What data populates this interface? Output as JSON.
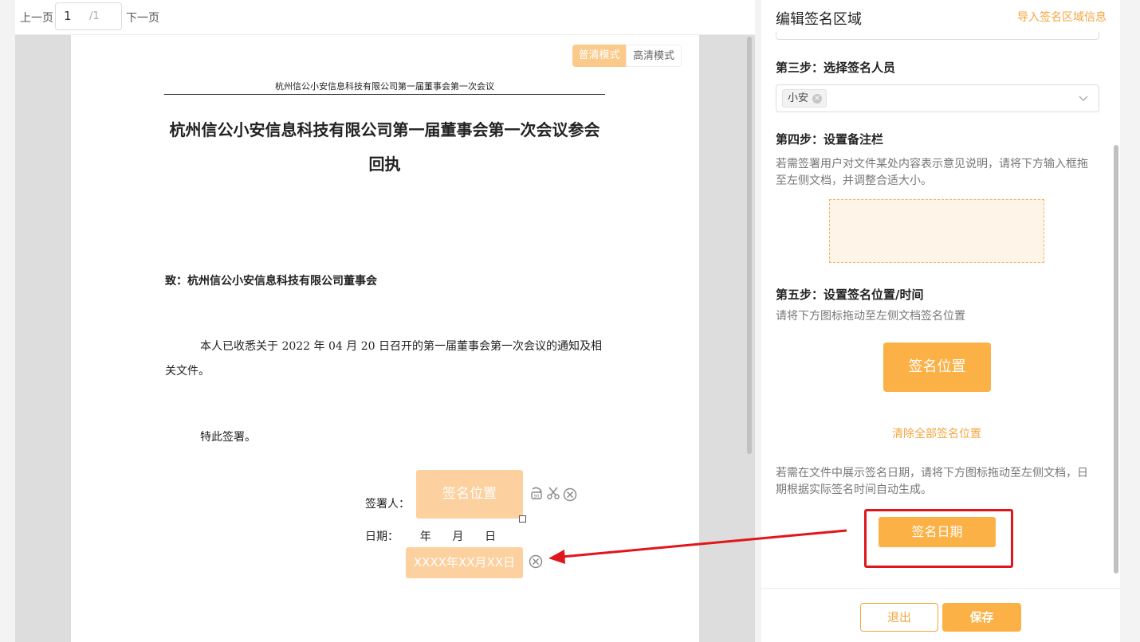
{
  "pager": {
    "prev_label": "上一页",
    "current_page": "1",
    "total_pages": "/1",
    "next_label": "下一页"
  },
  "viewer": {
    "mode_normal": "普清模式",
    "mode_hd": "高清模式"
  },
  "document": {
    "header": "杭州信公小安信息科技有限公司第一届董事会第一次会议",
    "title": "杭州信公小安信息科技有限公司第一届董事会第一次会议参会回执",
    "to": "致：杭州信公小安信息科技有限公司董事会",
    "body": "本人已收悉关于 2022 年 04 月 20 日召开的第一届董事会第一次会议的通知及相关文件。",
    "closing": "特此签署。",
    "signer_label": "签署人：",
    "date_label": "日期：      年      月      日",
    "placed_sign_label": "签名位置",
    "placed_date_label": "XXXX年XX月XX日"
  },
  "panel": {
    "title": "编辑签名区域",
    "import_link": "导入签名区域信息",
    "step3_title": "第三步：选择签名人员",
    "selected_person": "小安",
    "step4_title": "第四步：设置备注栏",
    "step4_hint": "若需签署用户对文件某处内容表示意见说明，请将下方输入框拖至左侧文档，并调整合适大小。",
    "step5_title": "第五步：设置签名位置/时间",
    "step5_hint": "请将下方图标拖动至左侧文档签名位置",
    "sign_drag_label": "签名位置",
    "clear_link": "清除全部签名位置",
    "date_hint": "若需在文件中展示签名日期，请将下方图标拖动至左侧文档，日期根据实际签名时间自动生成。",
    "date_drag_label": "签名日期",
    "exit_label": "退出",
    "save_label": "保存"
  },
  "colors": {
    "accent": "#fbb146",
    "accent_light": "#fdd19f",
    "link": "#f4a640",
    "annotation_red": "#e0161c"
  }
}
